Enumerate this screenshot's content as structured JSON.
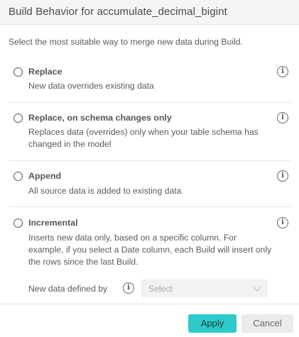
{
  "dialog": {
    "title": "Build Behavior for accumulate_decimal_bigint",
    "intro": "Select the most suitable way to merge new data during Build."
  },
  "options": [
    {
      "title": "Replace",
      "description": "New data overrides existing data"
    },
    {
      "title": "Replace, on schema changes only",
      "description": "Replaces data (overrides) only when your table schema has changed in the model"
    },
    {
      "title": "Append",
      "description": "All source data is added to existing data"
    },
    {
      "title": "Incremental",
      "description": "Inserts new data only, based on a specific column. For example, if you select a Date column, each Build will insert only the rows since the last Build."
    }
  ],
  "incremental": {
    "label": "New data defined by",
    "select_value": "Select"
  },
  "icons": {
    "info": "info-icon",
    "chevron": "chevron-down-icon",
    "radio": "radio-button"
  },
  "footer": {
    "apply_label": "Apply",
    "cancel_label": "Cancel"
  },
  "colors": {
    "accent": "#2ec9c9",
    "header_bg": "#f4f4f4"
  },
  "info_glyph": "i"
}
